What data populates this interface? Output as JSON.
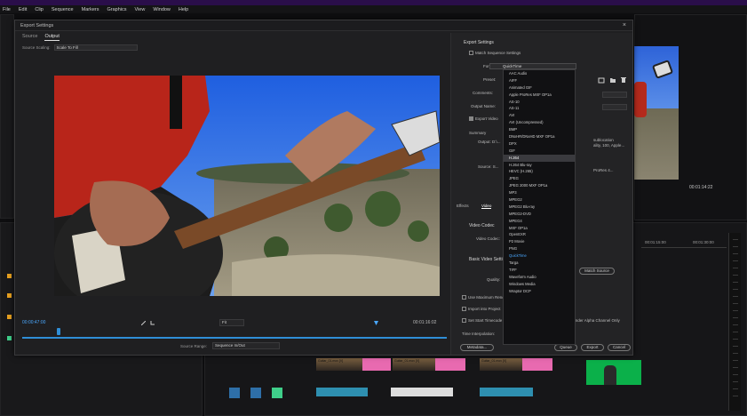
{
  "app": {
    "menu": [
      "File",
      "Edit",
      "Clip",
      "Sequence",
      "Markers",
      "Graphics",
      "View",
      "Window",
      "Help"
    ]
  },
  "program_monitor": {
    "timecode": "00:01:14:22"
  },
  "timeline": {
    "timecodes": [
      "00:01:15:00",
      "00:01:30:00"
    ],
    "clip_labels": [
      "Guitar_01.mov [V]",
      "Guitar_01.mov [V]",
      "Guitar_01.mov [V]"
    ]
  },
  "dialog": {
    "title": "Export Settings",
    "close_glyph": "×",
    "tabs": [
      {
        "label": "Source",
        "active": false
      },
      {
        "label": "Output",
        "active": true
      }
    ],
    "source_scaling_label": "Source Scaling:",
    "source_scaling_value": "Scale To Fill",
    "timecode_current": "00:00:47:00",
    "timecode_total": "00:01:16:02",
    "fit_value": "Fit",
    "source_range_label": "Source Range:",
    "source_range_value": "Sequence In/Out"
  },
  "export_settings": {
    "section_title": "Export Settings",
    "match_sequence_label": "Match Sequence Settings",
    "format_label": "Format:",
    "format_value": "QuickTime",
    "preset_label": "Preset:",
    "comments_label": "Comments:",
    "output_name_label": "Output Name:",
    "export_video_label": "Export Video",
    "summary_label": "Summary",
    "output_label": "Output: D:\\...",
    "source_label": "Source: S...",
    "summary_right_1": "sublocation",
    "summary_right_2": "ality, 100, Apple...",
    "summary_right_3": "ProRes 4...",
    "tabs": [
      "Effects",
      "Video",
      "Audio"
    ],
    "video_codec_section": "Video Codec",
    "video_codec_label": "Video Codec:",
    "basic_video_label": "Basic Video Settings",
    "quality_label": "Quality:",
    "match_source_btn": "Match Source",
    "use_max_render_label": "Use Maximum Render Quality",
    "import_into_project_label": "Import into Project",
    "set_start_tc_label": "Set Start Timecode",
    "time_interp_label": "Time Interpolation:",
    "render_alpha_label": "Render Alpha Channel Only",
    "metadata_btn": "Metadata...",
    "queue_btn": "Queue",
    "export_btn": "Export",
    "cancel_btn": "Cancel"
  },
  "format_options": [
    "AAC Audio",
    "AIFF",
    "Animated GIF",
    "Apple ProRes MXF OP1a",
    "AS-10",
    "AS-11",
    "AVI",
    "AVI (Uncompressed)",
    "BMP",
    "DNxHR/DNxHD MXF OP1a",
    "DPX",
    "GIF",
    "H.264",
    "H.264 Blu-ray",
    "HEVC (H.265)",
    "JPEG",
    "JPEG 2000 MXF OP1a",
    "MP3",
    "MPEG2",
    "MPEG2 Blu-ray",
    "MPEG2-DVD",
    "MPEG4",
    "MXF OP1a",
    "OpenEXR",
    "P2 Movie",
    "PNG",
    "QuickTime",
    "Targa",
    "TIFF",
    "Waveform Audio",
    "Windows Media",
    "Wraptor DCP"
  ],
  "format_highlighted_index": 12,
  "format_selected_index": 26,
  "colors": {
    "accent_blue": "#2f8ed6",
    "title_purple": "#2a0e4a",
    "clip_pink": "#e86ab0",
    "green_screen": "#0bb04a"
  }
}
